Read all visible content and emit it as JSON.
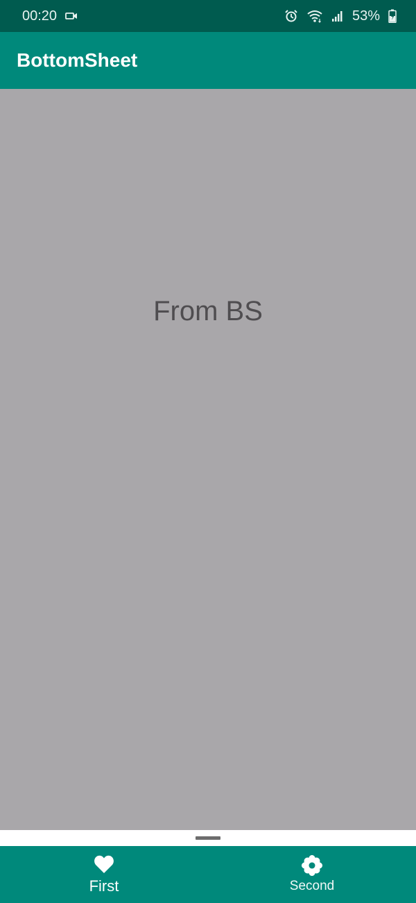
{
  "status_bar": {
    "time": "00:20",
    "battery_percent": "53%",
    "icons": [
      "video-camera-icon",
      "alarm-icon",
      "wifi-icon",
      "signal-icon",
      "battery-charging-icon"
    ]
  },
  "app_bar": {
    "title": "BottomSheet"
  },
  "content": {
    "message": "From BS"
  },
  "bottom_nav": {
    "items": [
      {
        "label": "First",
        "icon": "heart-icon",
        "selected": true
      },
      {
        "label": "Second",
        "icon": "flower-icon",
        "selected": false
      }
    ]
  },
  "colors": {
    "status_bar": "#005b4f",
    "primary": "#00897b",
    "scrim_background": "#a9a7aa",
    "sheet_handle": "#6d6d6d"
  }
}
